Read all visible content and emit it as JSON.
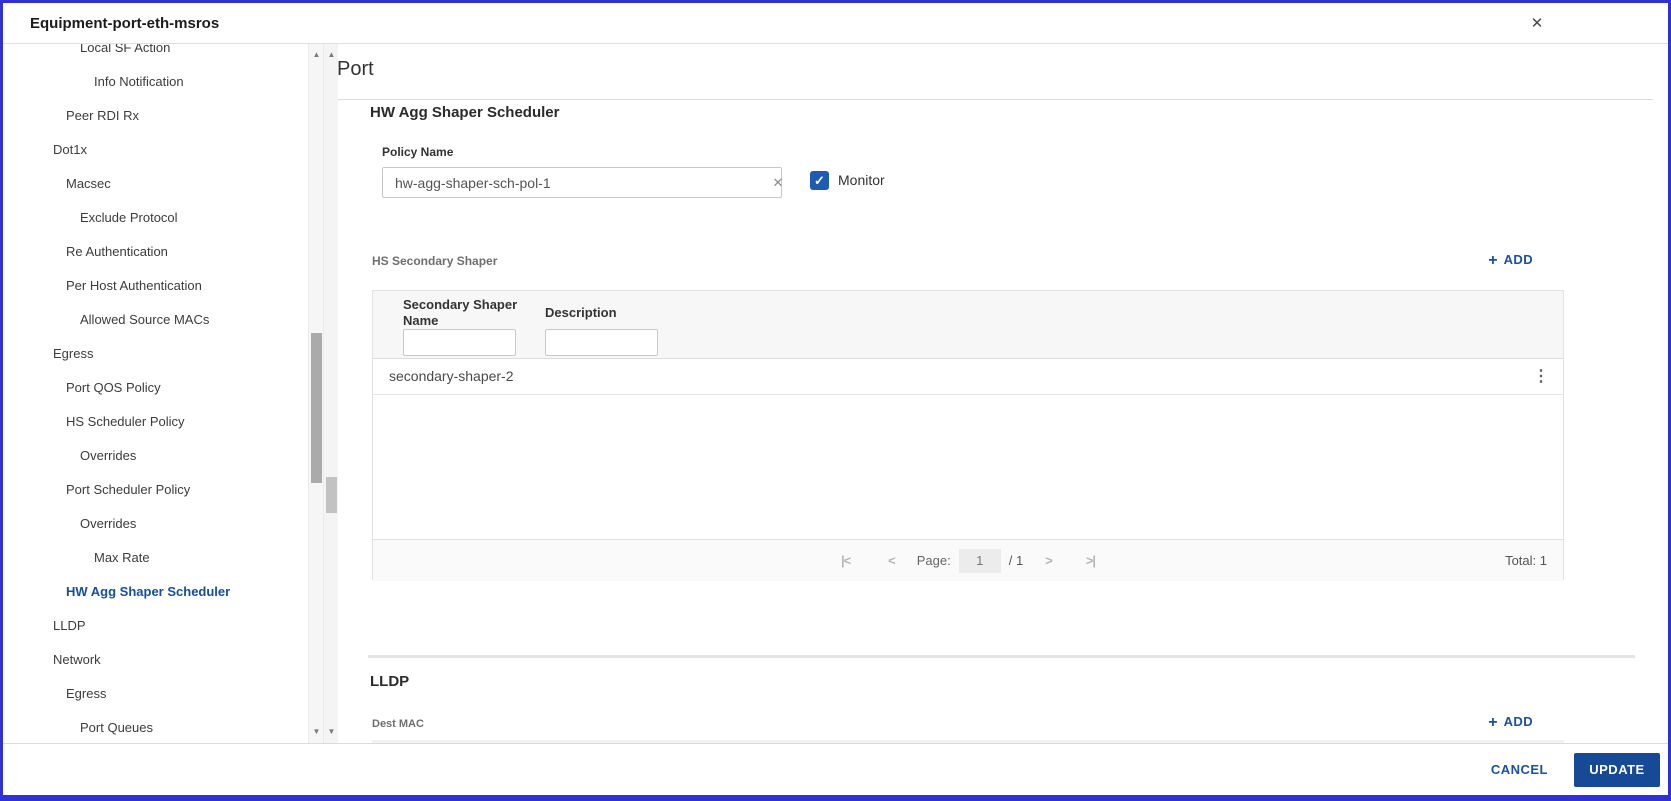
{
  "window": {
    "title": "Equipment-port-eth-msros"
  },
  "icons": {
    "close": "✕",
    "clear": "✕",
    "check": "✓",
    "kebab": "⋮",
    "plus": "+",
    "first_page": "|<",
    "prev_page": "<",
    "next_page": ">",
    "last_page": ">|",
    "scroll_up": "▲",
    "scroll_down": "▼"
  },
  "colors": {
    "accent_blue": "#1a50a5",
    "update_button_blue": "#174a94",
    "checkbox_blue": "#1f5ab3",
    "frame_border_blue": "#3030d4",
    "selected_item_blue": "#164e9e"
  },
  "sidebar": {
    "items": [
      {
        "label": "Local SF Action"
      },
      {
        "label": "Info Notification"
      },
      {
        "label": "Peer RDI Rx"
      },
      {
        "label": "Dot1x"
      },
      {
        "label": "Macsec"
      },
      {
        "label": "Exclude Protocol"
      },
      {
        "label": "Re Authentication"
      },
      {
        "label": "Per Host Authentication"
      },
      {
        "label": "Allowed Source MACs"
      },
      {
        "label": "Egress"
      },
      {
        "label": "Port QOS Policy"
      },
      {
        "label": "HS Scheduler Policy"
      },
      {
        "label": "Overrides"
      },
      {
        "label": "Port Scheduler Policy"
      },
      {
        "label": "Overrides"
      },
      {
        "label": "Max Rate"
      },
      {
        "label": "HW Agg Shaper Scheduler"
      },
      {
        "label": "LLDP"
      },
      {
        "label": "Network"
      },
      {
        "label": "Egress"
      },
      {
        "label": "Port Queues"
      }
    ],
    "selected": "HW Agg Shaper Scheduler"
  },
  "main": {
    "page_title": "Port",
    "hw_agg": {
      "section_title": "HW Agg Shaper Scheduler",
      "policy_name_label": "Policy Name",
      "policy_name_value": "hw-agg-shaper-sch-pol-1",
      "monitor_label": "Monitor",
      "monitor_checked": true
    },
    "hs": {
      "label": "HS Secondary Shaper",
      "add_label": "ADD",
      "table": {
        "columns": [
          "Secondary Shaper Name",
          "Description"
        ],
        "filters": [
          "",
          ""
        ],
        "rows": [
          {
            "name": "secondary-shaper-2",
            "description": ""
          }
        ]
      },
      "pager": {
        "page_label": "Page:",
        "page_value": "1",
        "page_suffix": "/ 1",
        "total_label": "Total: 1"
      }
    },
    "lldp": {
      "section_title": "LLDP",
      "dest_mac_label": "Dest MAC",
      "add_label": "ADD"
    }
  },
  "footer": {
    "cancel_label": "CANCEL",
    "update_label": "UPDATE"
  }
}
